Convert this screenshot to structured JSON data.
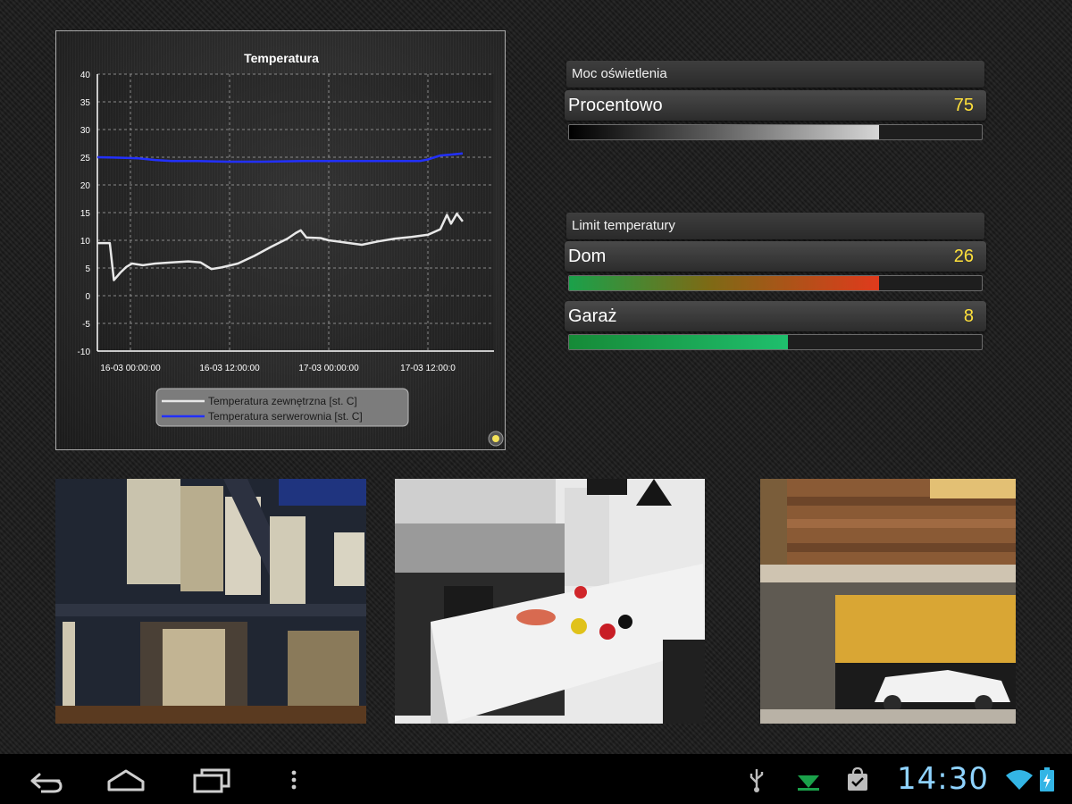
{
  "chart_data": {
    "type": "line",
    "title": "Temperatura",
    "x_tick_labels": [
      "16-03 00:00:00",
      "16-03 12:00:00",
      "17-03 00:00:00",
      "17-03 12:00:0"
    ],
    "x_unit": "hours since 15-03 20:00",
    "x_ticks_at": [
      4,
      16,
      28,
      40
    ],
    "xlim": [
      0,
      48
    ],
    "ylim": [
      -10,
      40
    ],
    "y_ticks": [
      -10,
      -5,
      0,
      5,
      10,
      15,
      20,
      25,
      30,
      35,
      40
    ],
    "grid": true,
    "legend_placement": "bottom-center",
    "series": [
      {
        "name": "Temperatura zewnętrzna [st. C]",
        "color": "#e8e8e8",
        "points": [
          [
            0,
            9.5
          ],
          [
            1.5,
            9.5
          ],
          [
            2,
            2.8
          ],
          [
            2.8,
            4.2
          ],
          [
            3.5,
            5.2
          ],
          [
            4.2,
            5.8
          ],
          [
            5.5,
            5.5
          ],
          [
            7,
            5.8
          ],
          [
            9,
            6.0
          ],
          [
            11,
            6.2
          ],
          [
            12.5,
            6.0
          ],
          [
            13.8,
            4.8
          ],
          [
            15,
            5.1
          ],
          [
            17,
            5.8
          ],
          [
            19,
            7.2
          ],
          [
            21,
            8.8
          ],
          [
            23,
            10.3
          ],
          [
            24,
            11.3
          ],
          [
            24.6,
            11.8
          ],
          [
            25.3,
            10.5
          ],
          [
            27,
            10.4
          ],
          [
            28,
            10.0
          ],
          [
            30,
            9.6
          ],
          [
            32,
            9.2
          ],
          [
            34,
            9.8
          ],
          [
            36,
            10.3
          ],
          [
            38,
            10.6
          ],
          [
            40,
            11.0
          ],
          [
            41.5,
            12.0
          ],
          [
            42.3,
            14.6
          ],
          [
            42.8,
            13.0
          ],
          [
            43.5,
            14.8
          ],
          [
            44.2,
            13.4
          ]
        ]
      },
      {
        "name": "Temperatura serwerownia [st. C]",
        "color": "#2230ff",
        "points": [
          [
            0,
            25.0
          ],
          [
            3,
            24.9
          ],
          [
            5,
            24.8
          ],
          [
            7,
            24.5
          ],
          [
            9,
            24.3
          ],
          [
            12,
            24.3
          ],
          [
            16,
            24.2
          ],
          [
            20,
            24.2
          ],
          [
            25,
            24.3
          ],
          [
            30,
            24.3
          ],
          [
            35,
            24.3
          ],
          [
            39,
            24.3
          ],
          [
            40,
            24.6
          ],
          [
            41.5,
            25.3
          ],
          [
            43,
            25.5
          ],
          [
            44.2,
            25.7
          ]
        ]
      }
    ]
  },
  "lighting": {
    "header": "Moc oświetlenia",
    "label": "Procentowo",
    "value": "75",
    "percent": 75
  },
  "temp_limit": {
    "header": "Limit temperatury",
    "rows": [
      {
        "label": "Dom",
        "value": "26",
        "percent": 75
      },
      {
        "label": "Garaż",
        "value": "8",
        "percent": 53
      }
    ]
  },
  "photos": [
    {
      "icon": "house-exterior-photo"
    },
    {
      "icon": "kitchen-photo"
    },
    {
      "icon": "garage-photo"
    }
  ],
  "statusbar": {
    "time": "14:30",
    "accent": "#8fd3ff"
  }
}
